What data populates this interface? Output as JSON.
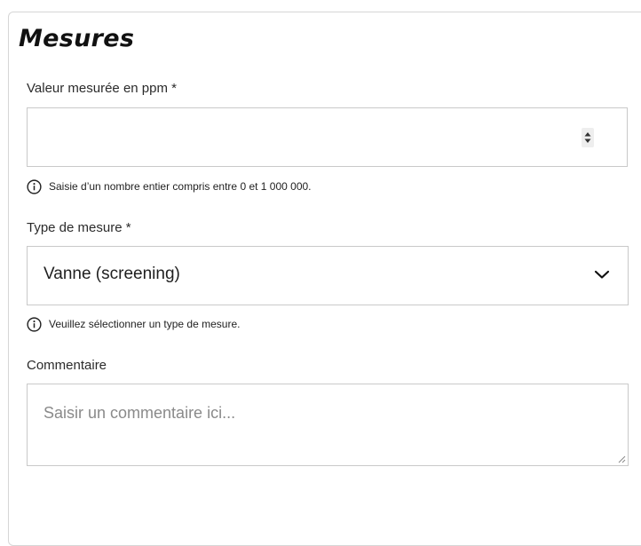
{
  "section": {
    "title": "Mesures"
  },
  "ppm_field": {
    "label": "Valeur mesurée en ppm *",
    "value": "",
    "hint": "Saisie d’un nombre entier compris entre 0 et 1 000 000."
  },
  "measure_type": {
    "label": "Type de mesure *",
    "selected": "Vanne (screening)",
    "hint": "Veuillez sélectionner un type de mesure."
  },
  "comment": {
    "label": "Commentaire",
    "placeholder": "Saisir un commentaire ici..."
  },
  "icons": {
    "info": "info-circle-icon",
    "dropdown": "chevron-down-icon",
    "spinner": "spinner-arrows-icon",
    "resize": "resize-handle-icon"
  }
}
